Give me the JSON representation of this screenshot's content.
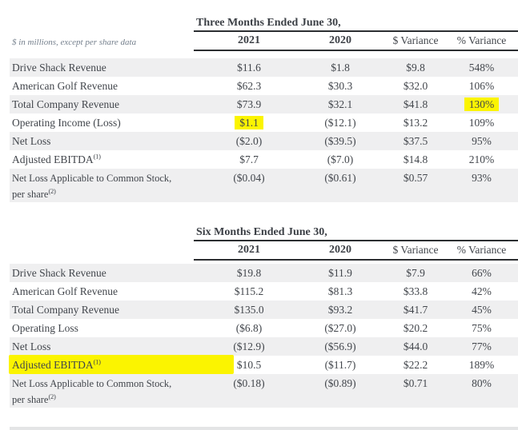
{
  "page": {
    "note": "$ in millions, except per share data"
  },
  "colors": {
    "highlight": "#fbf400",
    "row_shade": "#efeff0",
    "text": "#42464c",
    "rule": "#2c2e31"
  },
  "tables": [
    {
      "title": "Three Months Ended June 30,",
      "columns": [
        "2021",
        "2020",
        "$ Variance",
        "% Variance"
      ],
      "rows": [
        {
          "label": "Drive Shack Revenue",
          "values": [
            "$11.6",
            "$1.8",
            "$9.8",
            "548%"
          ],
          "shaded": true
        },
        {
          "label": "American Golf Revenue",
          "values": [
            "$62.3",
            "$30.3",
            "$32.0",
            "106%"
          ],
          "shaded": false
        },
        {
          "label": "Total Company Revenue",
          "values": [
            "$73.9",
            "$32.1",
            "$41.8",
            "130%"
          ],
          "shaded": true,
          "highlight_cols": [
            3
          ]
        },
        {
          "label": "Operating Income (Loss)",
          "values": [
            "$1.1",
            "($12.1)",
            "$13.2",
            "109%"
          ],
          "shaded": false,
          "highlight_cols": [
            0
          ]
        },
        {
          "label": "Net Loss",
          "values": [
            "($2.0)",
            "($39.5)",
            "$37.5",
            "95%"
          ],
          "shaded": true
        },
        {
          "label": "Adjusted EBITDA",
          "label_sup": "(1)",
          "values": [
            "$7.7",
            "($7.0)",
            "$14.8",
            "210%"
          ],
          "shaded": false
        },
        {
          "label": "Net Loss Applicable to Common Stock,",
          "label_line2": "per share",
          "label2_sup": "(2)",
          "two_line": true,
          "values": [
            "($0.04)",
            "($0.61)",
            "$0.57",
            "93%"
          ],
          "shaded": true
        }
      ]
    },
    {
      "title": "Six Months Ended June 30,",
      "columns": [
        "2021",
        "2020",
        "$ Variance",
        "% Variance"
      ],
      "rows": [
        {
          "label": "Drive Shack Revenue",
          "values": [
            "$19.8",
            "$11.9",
            "$7.9",
            "66%"
          ],
          "shaded": true
        },
        {
          "label": "American Golf Revenue",
          "values": [
            "$115.2",
            "$81.3",
            "$33.8",
            "42%"
          ],
          "shaded": false
        },
        {
          "label": "Total Company Revenue",
          "values": [
            "$135.0",
            "$93.2",
            "$41.7",
            "45%"
          ],
          "shaded": true
        },
        {
          "label": "Operating Loss",
          "values": [
            "($6.8)",
            "($27.0)",
            "$20.2",
            "75%"
          ],
          "shaded": false
        },
        {
          "label": "Net Loss",
          "values": [
            "($12.9)",
            "($56.9)",
            "$44.0",
            "77%"
          ],
          "shaded": true
        },
        {
          "label": "Adjusted EBITDA",
          "label_sup": "(1)",
          "values": [
            "$10.5",
            "($11.7)",
            "$22.2",
            "189%"
          ],
          "shaded": false,
          "marker_highlight": true
        },
        {
          "label": "Net Loss Applicable to Common Stock,",
          "label_line2": "per share",
          "label2_sup": "(2)",
          "two_line": true,
          "values": [
            "($0.18)",
            "($0.89)",
            "$0.71",
            "80%"
          ],
          "shaded": true
        }
      ]
    }
  ]
}
